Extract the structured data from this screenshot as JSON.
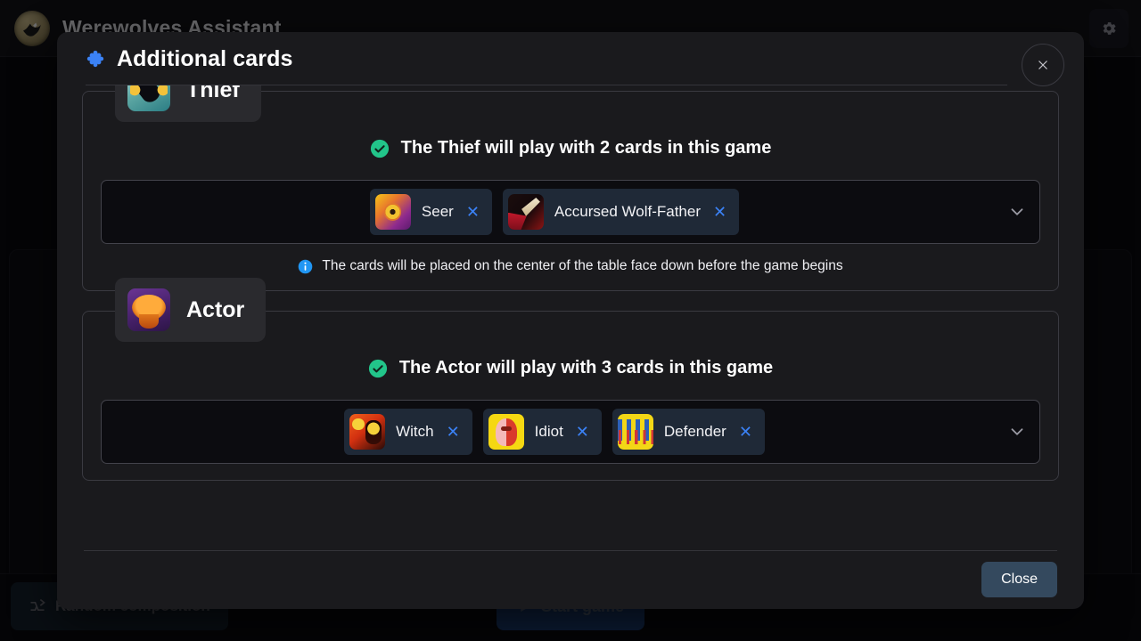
{
  "app": {
    "title": "Werewolves Assistant",
    "logo_icon": "wolf-icon",
    "settings_icon": "gear-icon",
    "footer": {
      "random_composition_label": "Random composition",
      "random_composition_icon": "shuffle-icon",
      "start_game_label": "Start game",
      "start_game_icon": "play-icon"
    }
  },
  "dialog": {
    "title": "Additional cards",
    "title_icon": "clover-icon",
    "close_icon": "close-icon",
    "close_button_label": "Close",
    "colors": {
      "surface": "#1a1a1d",
      "legend_surface": "#2a2a2e",
      "border": "#3a3a41",
      "chip_surface": "#1f2937",
      "accent_blue": "#3b82f6",
      "success_green": "#22c58a",
      "info_blue": "#2196f3",
      "close_button": "#34495e"
    },
    "sections": [
      {
        "role": "Thief",
        "role_image": "thief-card-image",
        "status_icon": "check-circle-icon",
        "status_text": "The Thief will play with 2 cards in this game",
        "chevron_icon": "chevron-down-icon",
        "cards": [
          {
            "label": "Seer",
            "image": "seer-card-image",
            "remove_icon": "remove-icon"
          },
          {
            "label": "Accursed Wolf-Father",
            "image": "accursed-wolf-father-card-image",
            "remove_icon": "remove-icon"
          }
        ],
        "hint_icon": "info-circle-icon",
        "hint_text": "The cards will be placed on the center of the table face down before the game begins"
      },
      {
        "role": "Actor",
        "role_image": "actor-card-image",
        "status_icon": "check-circle-icon",
        "status_text": "The Actor will play with 3 cards in this game",
        "chevron_icon": "chevron-down-icon",
        "cards": [
          {
            "label": "Witch",
            "image": "witch-card-image",
            "remove_icon": "remove-icon"
          },
          {
            "label": "Idiot",
            "image": "idiot-card-image",
            "remove_icon": "remove-icon"
          },
          {
            "label": "Defender",
            "image": "defender-card-image",
            "remove_icon": "remove-icon"
          }
        ],
        "hint_icon": "info-circle-icon",
        "hint_text": ""
      }
    ]
  }
}
